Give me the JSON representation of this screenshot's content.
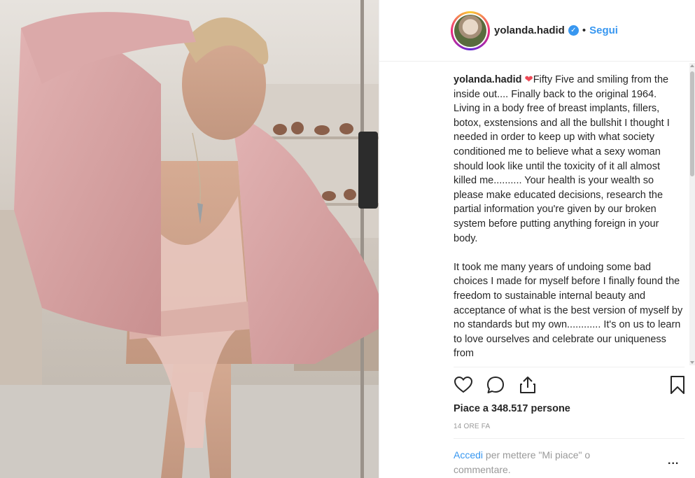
{
  "post": {
    "photo_alt": "Foto",
    "username": "yolanda.hadid",
    "separator": "•",
    "follow_label": "Segui",
    "verified_mark": "✓",
    "caption_username": "yolanda.hadid",
    "caption_heart": "❤",
    "caption_part1": "Fifty Five and smiling from the inside out.... Finally back to the original 1964. Living in a body free of breast implants, fillers, botox, exstensions and all the bullshit I thought I needed in order to keep up with what society conditioned me to believe what a sexy woman should look like until the toxicity of it all almost killed me.......... Your health is your wealth so please make educated decisions, research the partial information you're given by our broken system before putting anything foreign in your body.",
    "caption_part2": "It took me many years of undoing some bad choices I made for myself before I finally found the freedom to sustainable internal beauty and acceptance of what is the best version of myself by no standards but my own............ It's on us to learn to love ourselves and celebrate our uniqueness from",
    "likes_text": "Piace a 348.517 persone",
    "time_text": "14 ORE FA",
    "login_link": "Accedi",
    "login_rest": "per mettere \"Mi piace\" o commentare.",
    "more_label": "..."
  },
  "icons": [
    "heart-icon",
    "comment-icon",
    "share-icon",
    "bookmark-icon",
    "verified-icon",
    "more-icon"
  ],
  "colors": {
    "link": "#3897f0",
    "text": "#262626",
    "muted": "#999999",
    "verified": "#3897f0"
  }
}
